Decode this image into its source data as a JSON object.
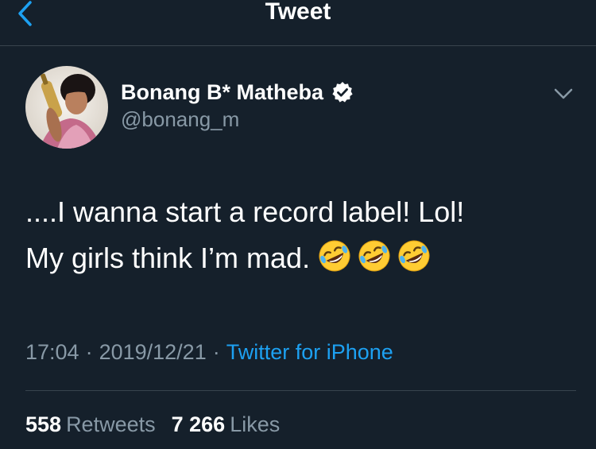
{
  "nav": {
    "title": "Tweet",
    "back_icon": "chevron-left-icon"
  },
  "author": {
    "name": "Bonang B* Matheba",
    "handle": "@bonang_m",
    "verified_icon": "verified-badge-icon",
    "more_icon": "chevron-down-icon"
  },
  "tweet": {
    "line1": "....I wanna start a record label! Lol!",
    "line2": "My girls think I’m mad.",
    "emojis": [
      "rolling-on-floor-laughing-emoji",
      "rolling-on-floor-laughing-emoji",
      "rolling-on-floor-laughing-emoji"
    ]
  },
  "meta": {
    "time": "17:04",
    "separator": "·",
    "date": "2019/12/21",
    "source": "Twitter for iPhone"
  },
  "stats": {
    "retweets_count": "558",
    "retweets_label": "Retweets",
    "likes_count": "7 266",
    "likes_label": "Likes"
  },
  "colors": {
    "background": "#15202b",
    "accent": "#1da1f2",
    "secondary_text": "#8899a6",
    "divider": "#38444d"
  }
}
